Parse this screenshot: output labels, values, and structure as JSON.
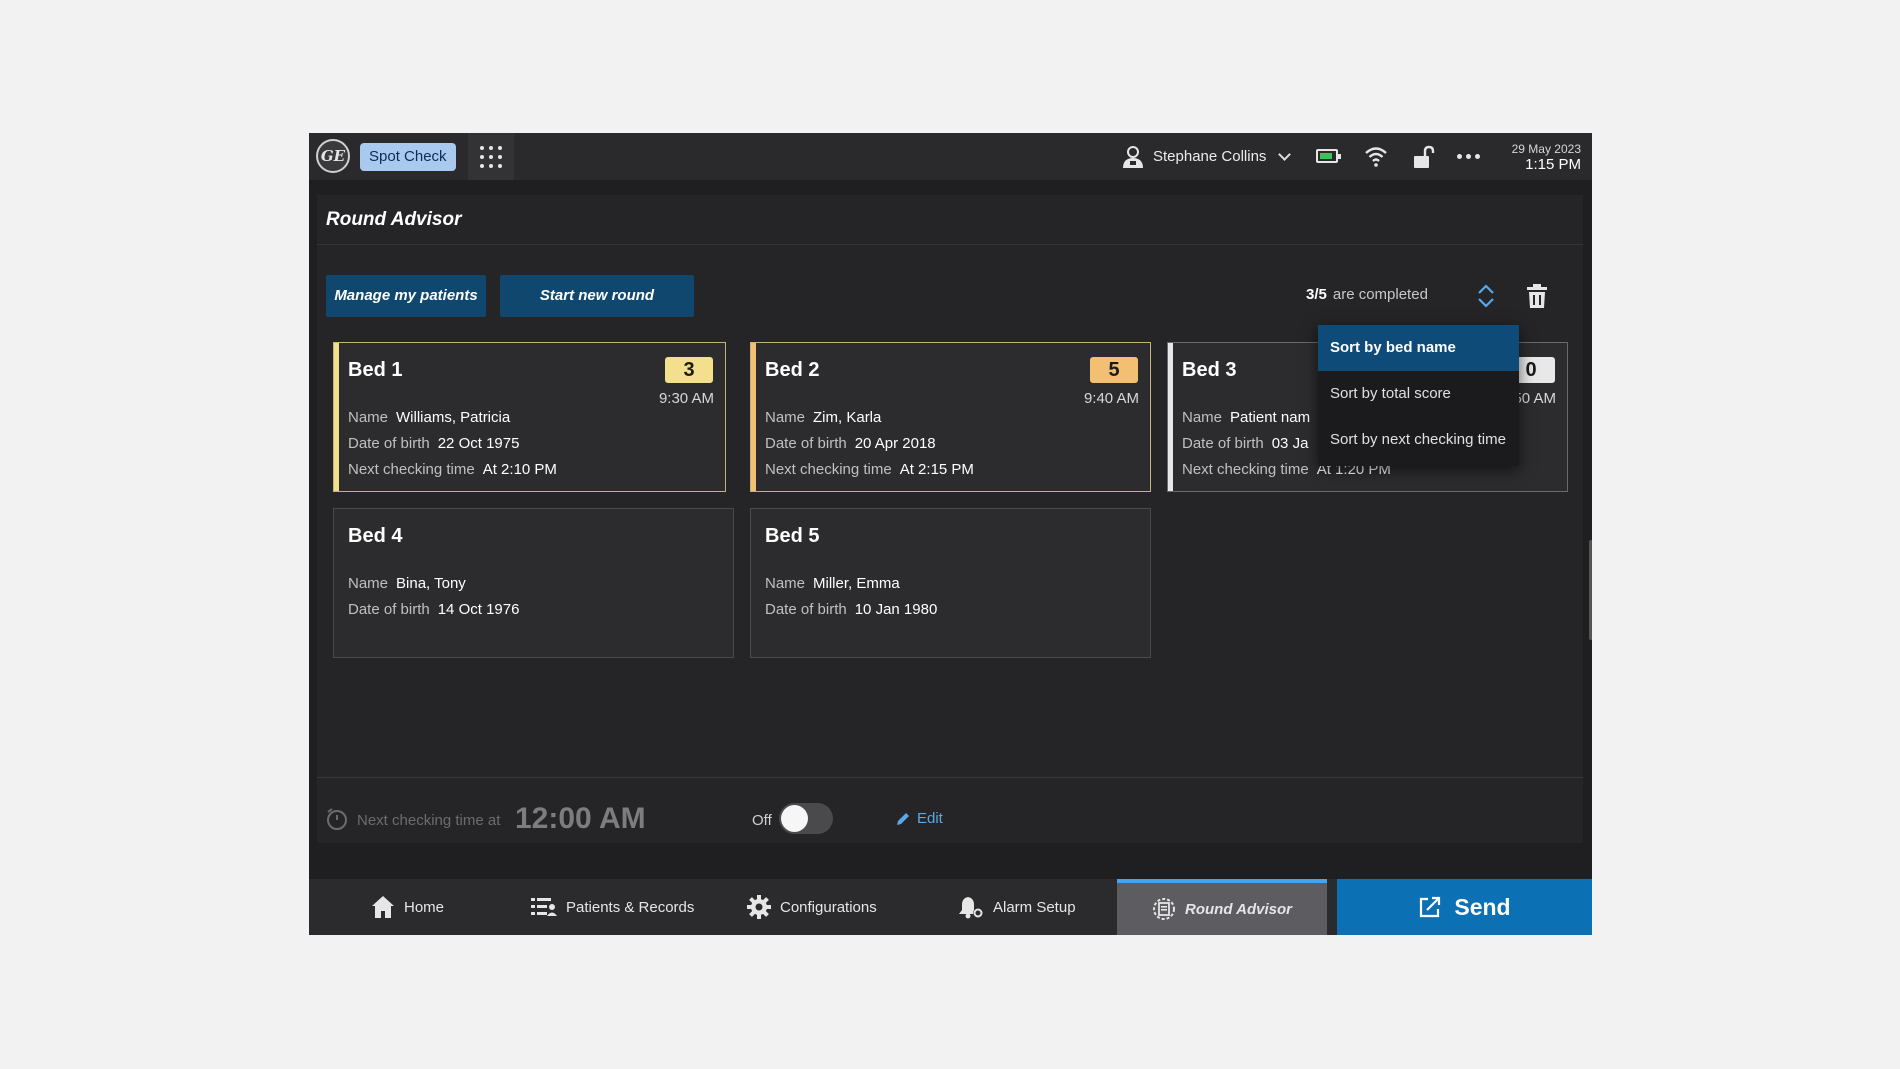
{
  "topbar": {
    "logo_text": "GE",
    "mode": "Spot Check",
    "user": "Stephane Collins",
    "date": "29 May 2023",
    "time": "1:15 PM",
    "battery_color": "#3fbf58"
  },
  "page": {
    "title": "Round Advisor",
    "manage_label": "Manage my patients",
    "start_label": "Start new round",
    "completed_count": "3/5",
    "completed_text": "are completed"
  },
  "beds": [
    {
      "name": "Bed 1",
      "score": "3",
      "time": "9:30 AM",
      "name_label": "Name",
      "patient": "Williams, Patricia",
      "dob_label": "Date of birth",
      "dob": "22 Oct 1975",
      "next_label": "Next checking time",
      "next": "At 2:10 PM"
    },
    {
      "name": "Bed 2",
      "score": "5",
      "time": "9:40 AM",
      "name_label": "Name",
      "patient": "Zim, Karla",
      "dob_label": "Date of birth",
      "dob": "20 Apr 2018",
      "next_label": "Next checking time",
      "next": "At 2:15 PM"
    },
    {
      "name": "Bed 3",
      "score": "0",
      "time": "50 AM",
      "name_label": "Name",
      "patient": "Patient nam",
      "dob_label": "Date of birth",
      "dob": "03 Ja",
      "next_label": "Next checking time",
      "next": "At 1:20 PM"
    },
    {
      "name": "Bed 4",
      "name_label": "Name",
      "patient": "Bina, Tony",
      "dob_label": "Date of birth",
      "dob": "14 Oct 1976"
    },
    {
      "name": "Bed 5",
      "name_label": "Name",
      "patient": "Miller, Emma",
      "dob_label": "Date of birth",
      "dob": "10 Jan 1980"
    }
  ],
  "sort_menu": {
    "options": [
      "Sort by bed name",
      "Sort by total score",
      "Sort by next checking time"
    ],
    "selected": "Sort by bed name"
  },
  "schedule": {
    "label": "Next checking time at",
    "time": "12:00 AM",
    "toggle_label": "Off",
    "toggle_on": false,
    "edit_label": "Edit"
  },
  "nav": {
    "items": [
      "Home",
      "Patients & Records",
      "Configurations",
      "Alarm Setup",
      "Round Advisor"
    ],
    "active": "Round Advisor",
    "send_label": "Send"
  },
  "colors": {
    "primary": "#10476e",
    "accent_blue": "#0b70b4",
    "score_yellow": "#f4df8c",
    "score_orange": "#f2bf73"
  }
}
